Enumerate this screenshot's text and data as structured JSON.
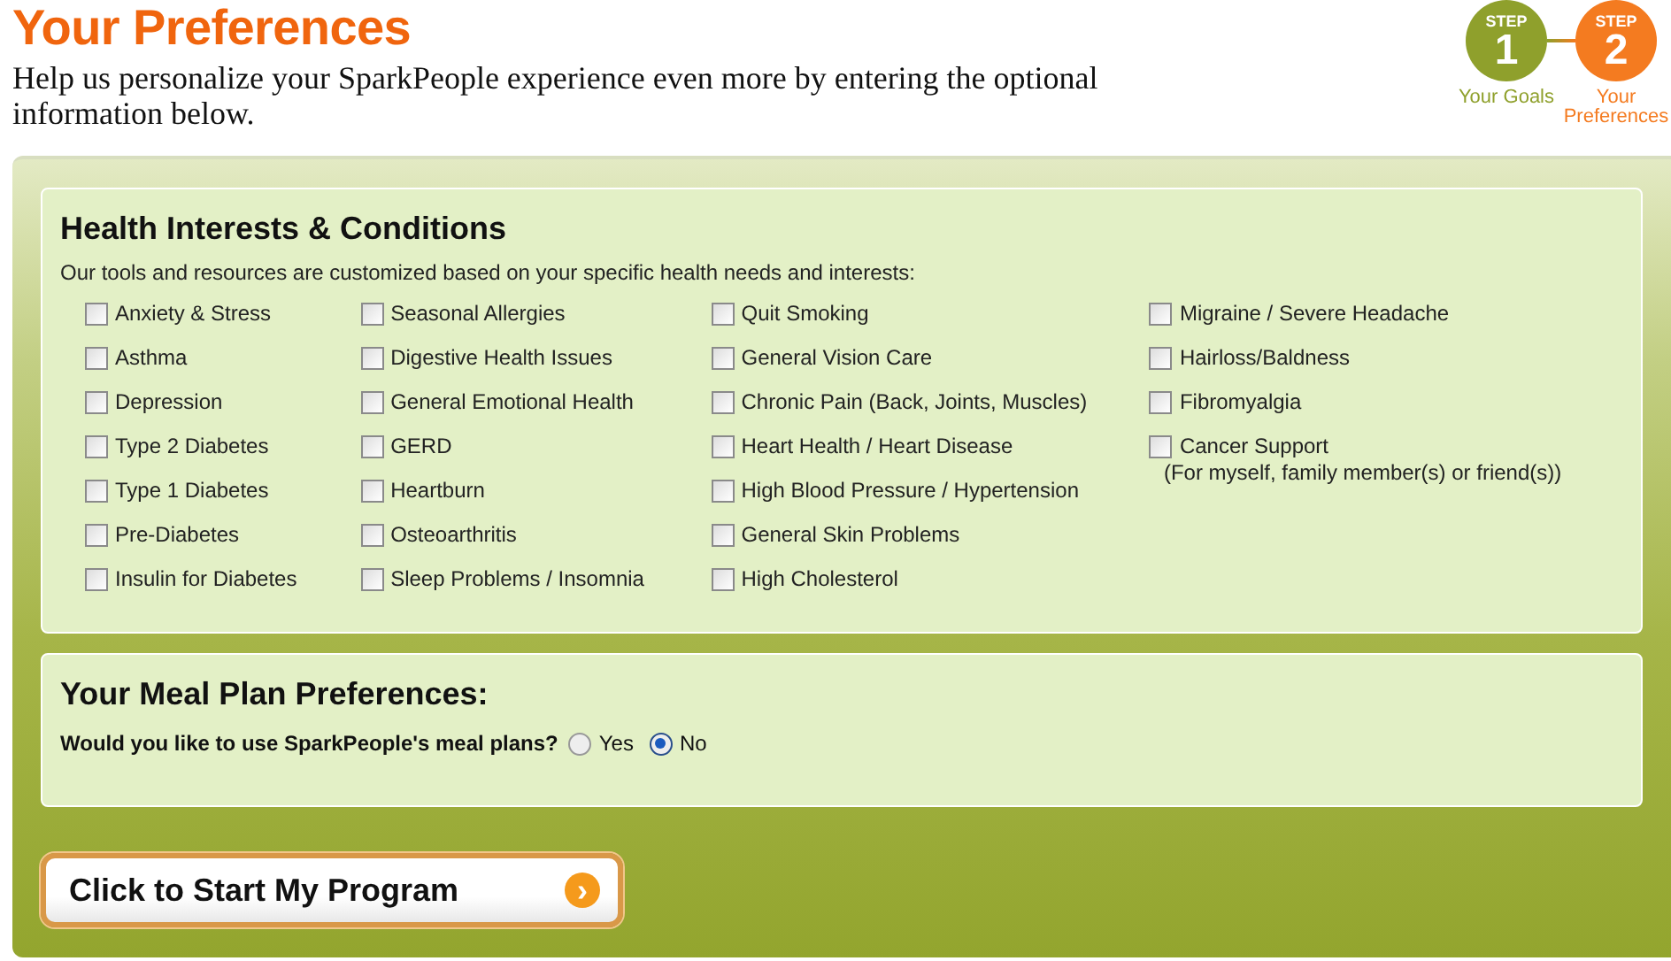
{
  "page": {
    "title": "Your Preferences",
    "intro": "Help us personalize your SparkPeople experience even more by entering the optional information below."
  },
  "steps": [
    {
      "caption": "STEP",
      "number": "1",
      "label": "Your Goals",
      "color": "#8fa02c"
    },
    {
      "caption": "STEP",
      "number": "2",
      "label": "Your Preferences",
      "color": "#f47b20"
    }
  ],
  "health": {
    "heading": "Health Interests & Conditions",
    "description": "Our tools and resources are customized based on your specific health needs and interests:",
    "columns": [
      [
        {
          "label": "Anxiety & Stress",
          "checked": false
        },
        {
          "label": "Asthma",
          "checked": false
        },
        {
          "label": "Depression",
          "checked": false
        },
        {
          "label": "Type 2 Diabetes",
          "checked": false
        },
        {
          "label": "Type 1 Diabetes",
          "checked": false
        },
        {
          "label": "Pre-Diabetes",
          "checked": false
        },
        {
          "label": "Insulin for Diabetes",
          "checked": false
        }
      ],
      [
        {
          "label": "Seasonal Allergies",
          "checked": false
        },
        {
          "label": "Digestive Health Issues",
          "checked": false
        },
        {
          "label": "General Emotional Health",
          "checked": false
        },
        {
          "label": "GERD",
          "checked": false
        },
        {
          "label": "Heartburn",
          "checked": false
        },
        {
          "label": "Osteoarthritis",
          "checked": false
        },
        {
          "label": "Sleep Problems / Insomnia",
          "checked": false
        }
      ],
      [
        {
          "label": "Quit Smoking",
          "checked": false
        },
        {
          "label": "General Vision Care",
          "checked": false
        },
        {
          "label": "Chronic Pain (Back, Joints, Muscles)",
          "checked": false
        },
        {
          "label": "Heart Health / Heart Disease",
          "checked": false
        },
        {
          "label": "High Blood Pressure / Hypertension",
          "checked": false
        },
        {
          "label": "General Skin Problems",
          "checked": false
        },
        {
          "label": "High Cholesterol",
          "checked": false
        }
      ],
      [
        {
          "label": "Migraine / Severe Headache",
          "checked": false
        },
        {
          "label": "Hairloss/Baldness",
          "checked": false
        },
        {
          "label": "Fibromyalgia",
          "checked": false
        },
        {
          "label": "Cancer Support",
          "checked": false,
          "note": "(For myself, family member(s) or friend(s))"
        }
      ]
    ]
  },
  "meal_plan": {
    "heading": "Your Meal Plan Preferences:",
    "question": "Would you like to use SparkPeople's meal plans?",
    "options": [
      {
        "label": "Yes",
        "selected": false
      },
      {
        "label": "No",
        "selected": true
      }
    ]
  },
  "start_button": {
    "label": "Click to Start My Program",
    "icon": "›"
  }
}
